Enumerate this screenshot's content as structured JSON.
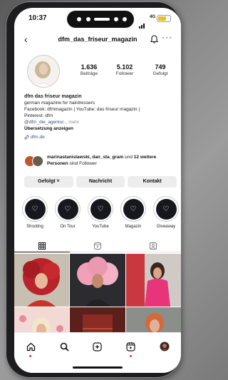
{
  "status_bar": {
    "time": "10:37",
    "network": "4G",
    "battery_level": 0.7
  },
  "header": {
    "username": "dfm_das_friseur_magazin",
    "back_icon": "chevron-left-icon",
    "bell_icon": "bell-icon",
    "more_icon": "more-horizontal-icon"
  },
  "stats": [
    {
      "value": "1.636",
      "label": "Beiträge"
    },
    {
      "value": "5.102",
      "label": "Follower"
    },
    {
      "value": "749",
      "label": "Gefolgt"
    }
  ],
  "bio": {
    "name": "dfm das friseur magazin",
    "line1": "german magazine for hairdressers",
    "line2": "Facebook: dfmmagazin | YouTube: das friseur magazin |",
    "line3": "Pinterest: dfm",
    "mention": "@dfm_die_agentur...",
    "more": "mehr",
    "translate": "Übersetzung anzeigen",
    "website": "dfm.de"
  },
  "followed_by": {
    "names": "marinastanislawski, dan_sta_gram",
    "connector": "und",
    "rest": "12 weitere Personen",
    "suffix": "sind Follower"
  },
  "buttons": {
    "following": "Gefolgt ˅",
    "message": "Nachricht",
    "contact": "Kontakt"
  },
  "highlights": [
    {
      "label": "Shooting"
    },
    {
      "label": "On Tour"
    },
    {
      "label": "YouTube"
    },
    {
      "label": "Magazin"
    },
    {
      "label": "Giveaway"
    }
  ],
  "tabs": [
    "grid-icon",
    "reels-icon",
    "tagged-icon"
  ],
  "bottom_nav": [
    "home-icon",
    "search-icon",
    "create-icon",
    "reels-icon",
    "profile-avatar"
  ],
  "colors": {
    "link": "#3b4f7a",
    "accent_dot": "#e33333",
    "highlight_bg": "#16181d"
  }
}
